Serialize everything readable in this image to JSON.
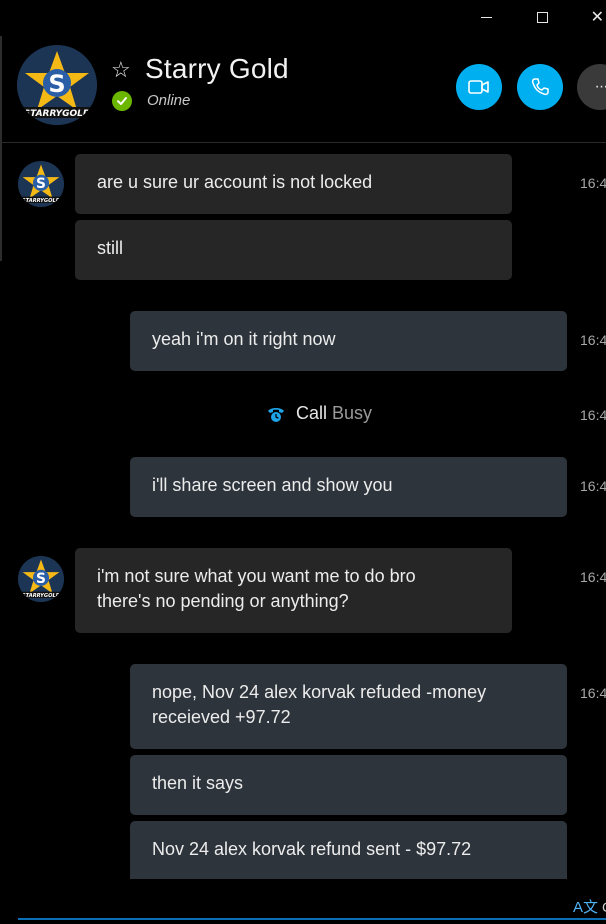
{
  "window": {
    "minimize_icon": "minimize-icon",
    "maximize_icon": "maximize-icon",
    "close_icon": "close-icon",
    "close_glyph": "✕"
  },
  "header": {
    "contact_name": "Starry Gold",
    "status": "Online",
    "favorite_glyph": "☆",
    "avatar_text": "STARRYGOLD",
    "avatar_letter": "S",
    "more_glyph": "···"
  },
  "colors": {
    "accent": "#00aff0",
    "online": "#6bb700",
    "incoming_bubble": "#262626",
    "outgoing_bubble": "#2d343b"
  },
  "messages": [
    {
      "direction": "in",
      "text": "are u sure ur account is not locked",
      "time": "16:4"
    },
    {
      "direction": "in",
      "text": "still",
      "time": ""
    },
    {
      "direction": "out",
      "text": "yeah i'm on it right now",
      "time": "16:4"
    },
    {
      "direction": "out",
      "text": "i'll share screen and show you",
      "time": "16:4"
    },
    {
      "direction": "in",
      "text": "i'm not sure what you want me to do bro there's no pending or anything?",
      "time": "16:4"
    },
    {
      "direction": "out",
      "text": "nope, Nov 24 alex korvak refuded -money receieved +97.72",
      "time": "16:4"
    },
    {
      "direction": "out",
      "text": "then it says",
      "time": ""
    },
    {
      "direction": "out",
      "text": "Nov 24 alex korvak refund sent - $97.72",
      "time": ""
    }
  ],
  "call_event": {
    "label": "Call",
    "status": "Busy",
    "time": "16:4",
    "icon": "phone-clock-icon"
  },
  "footer": {
    "translate_label": "C",
    "translate_glyph": "A文"
  }
}
